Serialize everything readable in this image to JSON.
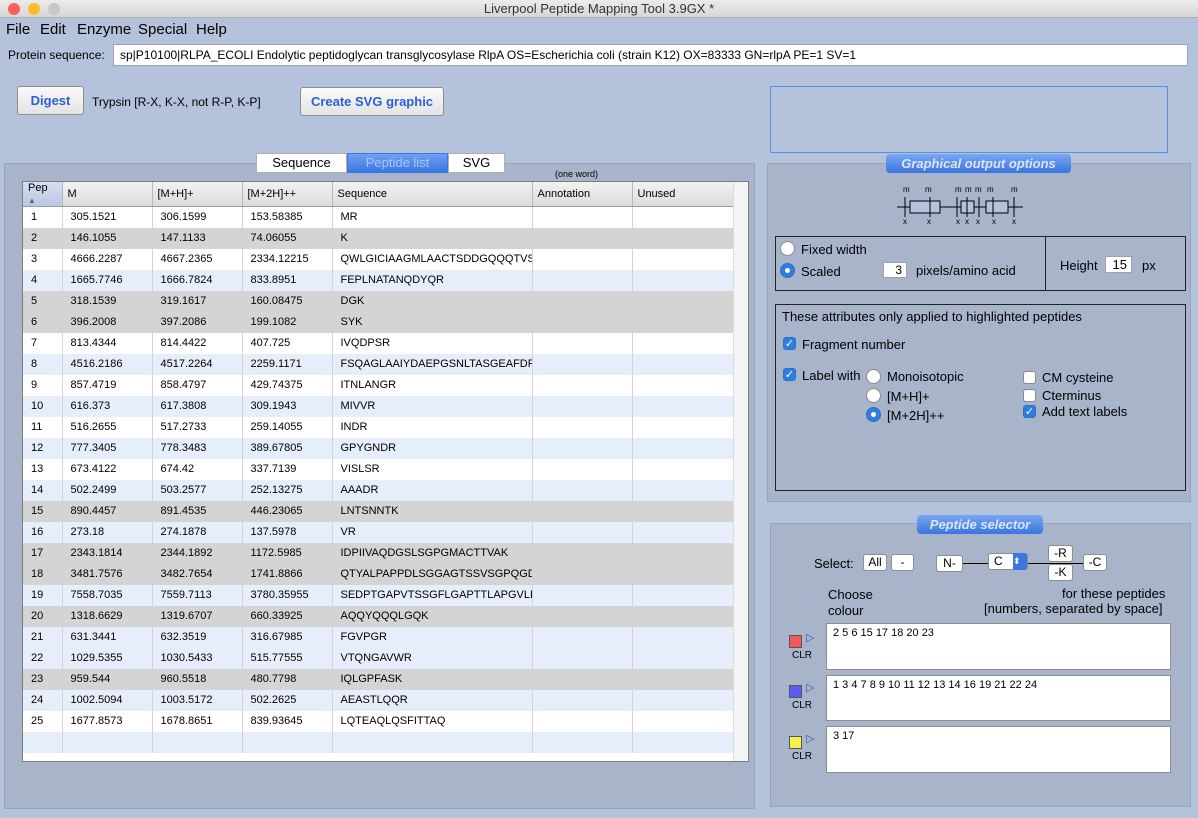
{
  "window": {
    "title": "Liverpool Peptide Mapping Tool 3.9GX *"
  },
  "menu": [
    "File",
    "Edit",
    "Enzyme",
    "Special",
    "Help"
  ],
  "protein": {
    "label": "Protein sequence:",
    "value": "sp|P10100|RLPA_ECOLI Endolytic peptidoglycan transglycosylase RlpA OS=Escherichia coli (strain K12) OX=83333 GN=rlpA PE=1 SV=1"
  },
  "digest": {
    "button": "Digest",
    "enzyme_text": "Trypsin [R-X, K-X, not R-P, K-P]"
  },
  "svg_button": "Create SVG graphic",
  "tabs": [
    "Sequence",
    "Peptide list",
    "SVG"
  ],
  "annotation_hint": "(one word)",
  "table": {
    "columns": [
      "Pep",
      "M",
      "[M+H]+",
      "[M+2H]++",
      "Sequence",
      "Annotation",
      "Unused"
    ],
    "rows": [
      {
        "pep": "1",
        "m": "305.1521",
        "mh": "306.1599",
        "m2h": "153.58385",
        "seq": "MR",
        "hl": "white"
      },
      {
        "pep": "2",
        "m": "146.1055",
        "mh": "147.1133",
        "m2h": "74.06055",
        "seq": "K",
        "hl": "gray"
      },
      {
        "pep": "3",
        "m": "4666.2287",
        "mh": "4667.2365",
        "m2h": "2334.12215",
        "seq": "QWLGICIAAGMLAACTSDDGQQQTVS",
        "hl": "white"
      },
      {
        "pep": "4",
        "m": "1665.7746",
        "mh": "1666.7824",
        "m2h": "833.8951",
        "seq": "FEPLNATANQDYQR",
        "hl": "blue"
      },
      {
        "pep": "5",
        "m": "318.1539",
        "mh": "319.1617",
        "m2h": "160.08475",
        "seq": "DGK",
        "hl": "gray"
      },
      {
        "pep": "6",
        "m": "396.2008",
        "mh": "397.2086",
        "m2h": "199.1082",
        "seq": "SYK",
        "hl": "gray"
      },
      {
        "pep": "7",
        "m": "813.4344",
        "mh": "814.4422",
        "m2h": "407.725",
        "seq": "IVQDPSR",
        "hl": "white"
      },
      {
        "pep": "8",
        "m": "4516.2186",
        "mh": "4517.2264",
        "m2h": "2259.1171",
        "seq": "FSQAGLAAIYDAEPGSNLTASGEAFDP",
        "hl": "blue"
      },
      {
        "pep": "9",
        "m": "857.4719",
        "mh": "858.4797",
        "m2h": "429.74375",
        "seq": "ITNLANGR",
        "hl": "white"
      },
      {
        "pep": "10",
        "m": "616.373",
        "mh": "617.3808",
        "m2h": "309.1943",
        "seq": "MIVVR",
        "hl": "blue"
      },
      {
        "pep": "11",
        "m": "516.2655",
        "mh": "517.2733",
        "m2h": "259.14055",
        "seq": "INDR",
        "hl": "white"
      },
      {
        "pep": "12",
        "m": "777.3405",
        "mh": "778.3483",
        "m2h": "389.67805",
        "seq": "GPYGNDR",
        "hl": "blue"
      },
      {
        "pep": "13",
        "m": "673.4122",
        "mh": "674.42",
        "m2h": "337.7139",
        "seq": "VISLSR",
        "hl": "white"
      },
      {
        "pep": "14",
        "m": "502.2499",
        "mh": "503.2577",
        "m2h": "252.13275",
        "seq": "AAADR",
        "hl": "blue"
      },
      {
        "pep": "15",
        "m": "890.4457",
        "mh": "891.4535",
        "m2h": "446.23065",
        "seq": "LNTSNNTK",
        "hl": "gray"
      },
      {
        "pep": "16",
        "m": "273.18",
        "mh": "274.1878",
        "m2h": "137.5978",
        "seq": "VR",
        "hl": "blue"
      },
      {
        "pep": "17",
        "m": "2343.1814",
        "mh": "2344.1892",
        "m2h": "1172.5985",
        "seq": "IDPIIVAQDGSLSGPGMACTTVAK",
        "hl": "gray"
      },
      {
        "pep": "18",
        "m": "3481.7576",
        "mh": "3482.7654",
        "m2h": "1741.8866",
        "seq": "QTYALPAPPDLSGGAGTSSVSGPQGD",
        "hl": "gray"
      },
      {
        "pep": "19",
        "m": "7558.7035",
        "mh": "7559.7113",
        "m2h": "3780.35955",
        "seq": "SEDPTGAPVTSSGFLGAPTTLAPGVLE",
        "hl": "blue"
      },
      {
        "pep": "20",
        "m": "1318.6629",
        "mh": "1319.6707",
        "m2h": "660.33925",
        "seq": "AQQYQQQLGQK",
        "hl": "gray"
      },
      {
        "pep": "21",
        "m": "631.3441",
        "mh": "632.3519",
        "m2h": "316.67985",
        "seq": "FGVPGR",
        "hl": "blue"
      },
      {
        "pep": "22",
        "m": "1029.5355",
        "mh": "1030.5433",
        "m2h": "515.77555",
        "seq": "VTQNGAVWR",
        "hl": "blue"
      },
      {
        "pep": "23",
        "m": "959.544",
        "mh": "960.5518",
        "m2h": "480.7798",
        "seq": "IQLGPFASK",
        "hl": "gray"
      },
      {
        "pep": "24",
        "m": "1002.5094",
        "mh": "1003.5172",
        "m2h": "502.2625",
        "seq": "AEASTLQQR",
        "hl": "blue"
      },
      {
        "pep": "25",
        "m": "1677.8573",
        "mh": "1678.8651",
        "m2h": "839.93645",
        "seq": "LQTEAQLQSFITTAQ",
        "hl": "white"
      }
    ]
  },
  "graphical": {
    "title": "Graphical output options",
    "fixed_width": "Fixed width",
    "scaled": "Scaled",
    "pixels_value": "3",
    "pixels_label": "pixels/amino acid",
    "height_label": "Height",
    "height_value": "15",
    "height_unit": "px",
    "attr_note": "These attributes only applied to highlighted peptides",
    "fragment_number": "Fragment number",
    "label_with": "Label with",
    "monoisotopic": "Monoisotopic",
    "mh": "[M+H]+",
    "m2h": "[M+2H]++",
    "cm_cysteine": "CM cysteine",
    "cterminus": "Cterminus",
    "add_text_labels": "Add text labels"
  },
  "selector": {
    "title": "Peptide selector",
    "select_label": "Select:",
    "all": "All",
    "dash": "-",
    "n_term": "N-",
    "c_value": "C",
    "r_btn": "-R",
    "k_btn": "-K",
    "c_btn": "-C",
    "choose_colour": "Choose colour",
    "for_peptides": "for these peptides",
    "numbers_hint": "[numbers, separated by space]",
    "clr": "CLR",
    "groups": [
      {
        "color": "#f05a5a",
        "peptides": "2 5 6 15 17 18 20 23"
      },
      {
        "color": "#5b5bf0",
        "peptides": "1 3 4 7 8 9 10 11 12 13 14 16 19 21 22 24"
      },
      {
        "color": "#f6f04a",
        "peptides": "3 17"
      }
    ]
  }
}
